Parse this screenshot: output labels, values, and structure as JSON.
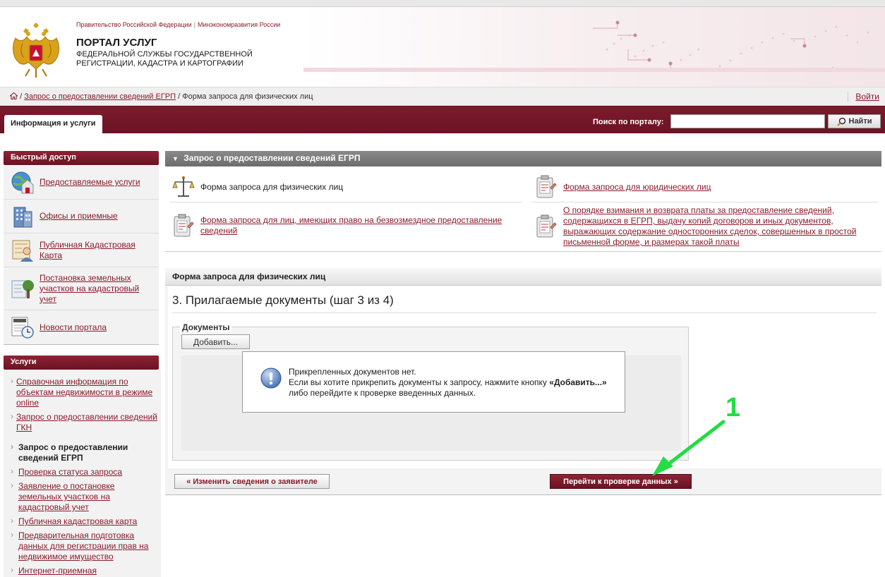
{
  "header": {
    "gov_link": "Правительство Российской Федерации",
    "ministry_link": "Минэкономразвития России",
    "separator": "|",
    "portal_title": "ПОРТАЛ УСЛУГ",
    "agency_name": "ФЕДЕРАЛЬНОЙ СЛУЖБЫ ГОСУДАРСТВЕННОЙ РЕГИСТРАЦИИ, КАДАСТРА И КАРТОГРАФИИ"
  },
  "breadcrumb": {
    "separator1": "/",
    "link": "Запрос о предоставлении сведений ЕГРП",
    "separator2": "/",
    "current": "Форма запроса для физических лиц"
  },
  "login": "Войти",
  "nav": {
    "tab": "Информация и услуги",
    "search_label": "Поиск по порталу:",
    "search_value": "",
    "search_button": "Найти"
  },
  "sidebar": {
    "quick_title": "Быстрый доступ",
    "quick_items": [
      {
        "label": "Предоставляемые услуги",
        "icon": "globe-house-icon"
      },
      {
        "label": "Офисы и приемные",
        "icon": "office-building-icon"
      },
      {
        "label": "Публичная Кадастровая Карта",
        "icon": "map-person-icon"
      },
      {
        "label": "Постановка земельных участков на кадастровый учет",
        "icon": "land-tree-icon"
      },
      {
        "label": "Новости портала",
        "icon": "news-clock-icon"
      }
    ],
    "services_title": "Услуги",
    "services": [
      {
        "label": "Справочная информация по объектам недвижимости в режиме online"
      },
      {
        "label": "Запрос о предоставлении сведений ГКН"
      },
      {
        "label": "Запрос о предоставлении сведений ЕГРП"
      },
      {
        "label": "Проверка статуса запроса"
      },
      {
        "label": "Заявление о постановке земельных участков на кадастровый учет"
      },
      {
        "label": "Публичная кадастровая карта"
      },
      {
        "label": "Предварительная подготовка данных для регистрации прав на недвижимое имущество"
      },
      {
        "label": "Интернет-приемная"
      }
    ]
  },
  "main": {
    "section_title": "Запрос о предоставлении сведений ЕГРП",
    "forms": [
      {
        "label": "Форма запроса для физических лиц",
        "icon": "scales-icon"
      },
      {
        "label": "Форма запроса для юридических лиц",
        "icon": "document-clipboard-icon"
      },
      {
        "label": "Форма запроса для лиц, имеющих право на безвозмездное предоставление сведений",
        "icon": "document-clipboard-icon"
      },
      {
        "label": "О порядке взимания и возврата платы за предоставление сведений, содержащихся в ЕГРП, выдачу копий договоров и иных документов, выражающих содержание односторонних сделок, совершенных в простой письменной форме, и размерах такой платы",
        "icon": "document-clipboard-icon"
      }
    ],
    "panel_title": "Форма запроса для физических лиц",
    "step_title": "3. Прилагаемые документы (шаг 3 из 4)",
    "docs_legend": "Документы",
    "add_button": "Добавить...",
    "message": {
      "line1": "Прикрепленных документов нет.",
      "line2_prefix": "Если вы хотите прикрепить документы к запросу, нажмите кнопку ",
      "line2_bold": "«Добавить...»",
      "line3": "либо перейдите к проверке введенных данных."
    },
    "back_button": "« Изменить сведения о заявителе",
    "next_button": "Перейти к проверке данных »"
  },
  "annotation": {
    "number": "1",
    "color": "#22dd44"
  },
  "colors": {
    "brand": "#7d1a2c",
    "link": "#8b1a2b",
    "section_gray": "#7a7a7a"
  }
}
